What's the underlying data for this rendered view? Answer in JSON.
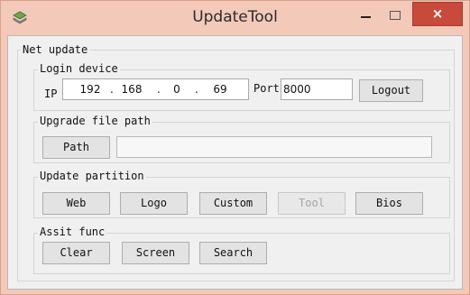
{
  "window": {
    "title": "UpdateTool",
    "close_label": "×",
    "app_icon": "shape-stack-icon",
    "colors": {
      "titlebar": "#f3c9b9",
      "close": "#c84a3a"
    }
  },
  "net_update": {
    "label": "Net update",
    "login": {
      "label": "Login device",
      "ip_label": "IP",
      "ip": [
        "192",
        "168",
        "0",
        "69"
      ],
      "port_label": "Port",
      "port_value": "8000",
      "logout_label": "Logout"
    },
    "upgrade_path": {
      "label": "Upgrade file path",
      "path_button": "Path",
      "path_value": ""
    },
    "update_partition": {
      "label": "Update partition",
      "buttons": [
        {
          "label": "Web",
          "enabled": true
        },
        {
          "label": "Logo",
          "enabled": true
        },
        {
          "label": "Custom",
          "enabled": true
        },
        {
          "label": "Tool",
          "enabled": false
        },
        {
          "label": "Bios",
          "enabled": true
        }
      ]
    },
    "assist_func": {
      "label": "Assit func",
      "buttons": [
        "Clear",
        "Screen",
        "Search"
      ]
    }
  }
}
